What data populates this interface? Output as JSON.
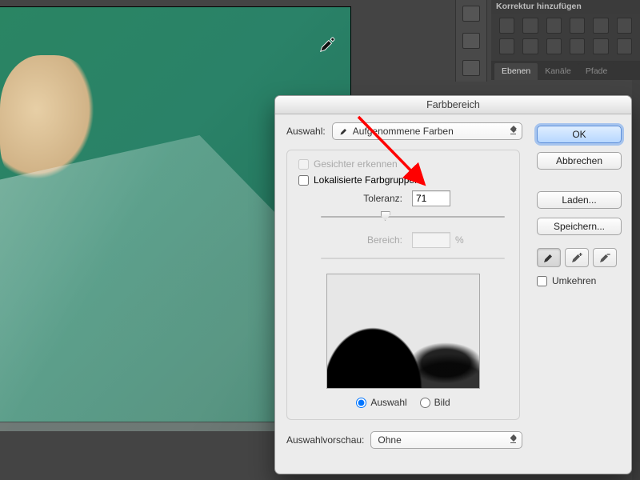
{
  "panel": {
    "title": "Korrektur hinzufügen",
    "tabs": [
      "Ebenen",
      "Kanäle",
      "Pfade"
    ],
    "active_tab": 0
  },
  "dialog": {
    "title": "Farbbereich",
    "selection_label": "Auswahl:",
    "selection_value": "Aufgenommene Farben",
    "detect_faces": {
      "label": "Gesichter erkennen",
      "checked": false,
      "enabled": false
    },
    "localized": {
      "label": "Lokalisierte Farbgruppen",
      "checked": false,
      "enabled": true
    },
    "tolerance": {
      "label": "Toleranz:",
      "value": "71",
      "pos_pct": 35
    },
    "range": {
      "label": "Bereich:",
      "value": "",
      "unit": "%",
      "enabled": false
    },
    "radios": {
      "selection": "Auswahl",
      "image": "Bild",
      "checked": "selection"
    },
    "preview_label": "Auswahlvorschau:",
    "preview_value": "Ohne",
    "buttons": {
      "ok": "OK",
      "cancel": "Abbrechen",
      "load": "Laden...",
      "save": "Speichern..."
    },
    "invert": {
      "label": "Umkehren",
      "checked": false
    },
    "eyedroppers": [
      "eyedropper",
      "eyedropper-plus",
      "eyedropper-minus"
    ]
  }
}
